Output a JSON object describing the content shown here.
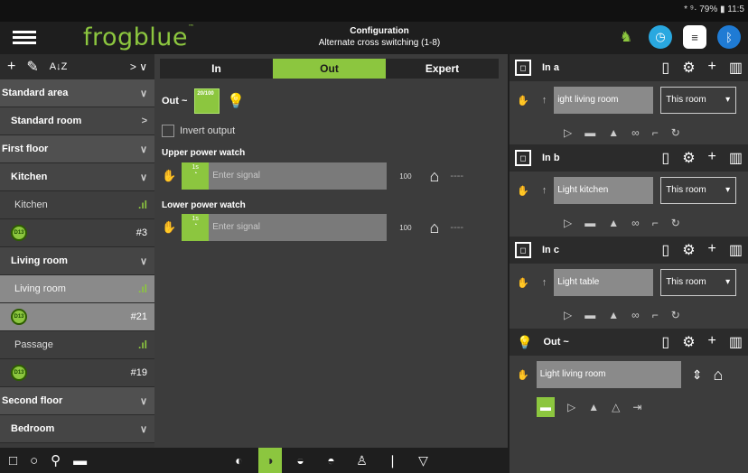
{
  "status": {
    "text": "* ⁹· 79% ▮ 11:5"
  },
  "app": {
    "logo": "frogblue",
    "logo_tm": "™",
    "title": "Configuration",
    "subtitle": "Alternate cross switching (1-8)"
  },
  "left": {
    "rows": [
      {
        "type": "area",
        "label": "Standard area",
        "chev": "∨"
      },
      {
        "type": "room",
        "label": "Standard room",
        "chev": ">"
      },
      {
        "type": "area",
        "label": "First floor",
        "chev": "∨"
      },
      {
        "type": "room",
        "label": "Kitchen",
        "chev": "∨"
      },
      {
        "type": "item",
        "label": "Kitchen",
        "chev": ".ıl"
      },
      {
        "type": "dev",
        "label": "#3",
        "chev": ""
      },
      {
        "type": "room",
        "label": "Living room",
        "chev": "∨"
      },
      {
        "type": "item sel",
        "label": "Living room",
        "chev": ".ıl"
      },
      {
        "type": "dev sel",
        "label": "#21",
        "chev": ""
      },
      {
        "type": "item",
        "label": "Passage",
        "chev": ".ıl"
      },
      {
        "type": "dev",
        "label": "#19",
        "chev": ""
      },
      {
        "type": "area",
        "label": "Second floor",
        "chev": "∨"
      },
      {
        "type": "room",
        "label": "Bedroom",
        "chev": "∨"
      }
    ],
    "device_icon_text": "D13"
  },
  "tabs": [
    "In",
    "Out",
    "Expert"
  ],
  "out": {
    "label": "Out ~",
    "box_text": "20/100",
    "invert_label": "Invert output",
    "upper_label": "Upper power watch",
    "lower_label": "Lower power watch",
    "green_text": "1s",
    "placeholder": "Enter signal",
    "value": "100"
  },
  "right": {
    "in_a": {
      "name": "In a",
      "text": "ight living room",
      "scope": "This room"
    },
    "in_b": {
      "name": "In b",
      "text": "Light kitchen",
      "scope": "This room"
    },
    "in_c": {
      "name": "In c",
      "text": "Light table",
      "scope": "This room"
    },
    "out": {
      "name": "Out ~",
      "text": "Light living room"
    }
  },
  "colors": {
    "accent": "#8cc63f"
  }
}
